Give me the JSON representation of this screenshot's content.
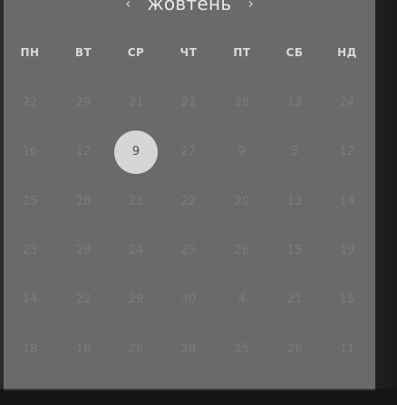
{
  "header": {
    "prev_icon": "‹",
    "month": "жовтень",
    "next_icon": "›"
  },
  "weekdays": [
    "ПН",
    "ВТ",
    "СР",
    "ЧТ",
    "ПТ",
    "СБ",
    "НД"
  ],
  "weeks": [
    [
      "22",
      "29",
      "21",
      "22",
      "28",
      "13",
      "24"
    ],
    [
      "16",
      "12",
      "9",
      "27",
      "9",
      "5",
      "12"
    ],
    [
      "25",
      "28",
      "23",
      "22",
      "20",
      "13",
      "14"
    ],
    [
      "23",
      "29",
      "24",
      "25",
      "26",
      "15",
      "19"
    ],
    [
      "14",
      "22",
      "29",
      "30",
      "4",
      "21",
      "15"
    ],
    [
      "18",
      "18",
      "26",
      "28",
      "15",
      "26",
      "11"
    ]
  ],
  "selected": {
    "week": 1,
    "day": 2
  },
  "colors": {
    "panel": "#6a6a6a",
    "background": "#151515",
    "selected_circle": "#d6d6d6",
    "day_text": "#7c7c7c",
    "weekday_text": "#d9d9d9"
  }
}
